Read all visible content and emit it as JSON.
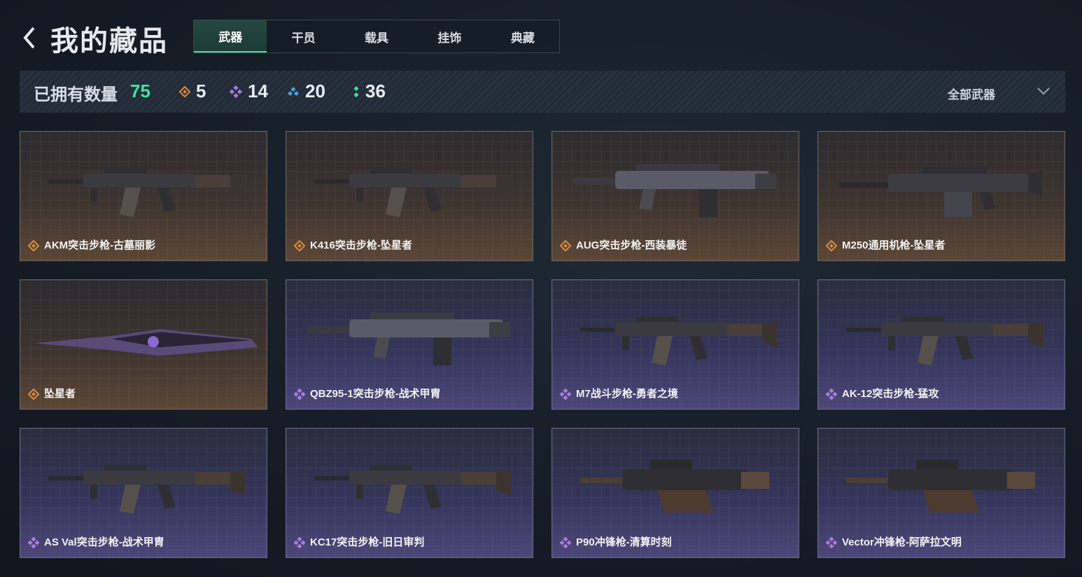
{
  "header": {
    "title": "我的藏品",
    "tabs": [
      {
        "label": "武器",
        "active": true
      },
      {
        "label": "干员",
        "active": false
      },
      {
        "label": "载具",
        "active": false
      },
      {
        "label": "挂饰",
        "active": false
      },
      {
        "label": "典藏",
        "active": false
      }
    ]
  },
  "stats": {
    "owned_label": "已拥有数量",
    "owned_value": "75",
    "rarity_counts": [
      {
        "icon": "orange-diamond-icon",
        "color": "#e08a3c",
        "value": "5"
      },
      {
        "icon": "purple-diamond-icon",
        "color": "#a77be0",
        "value": "14"
      },
      {
        "icon": "blue-diamond-icon",
        "color": "#4aa0e6",
        "value": "20"
      },
      {
        "icon": "green-dots-icon",
        "color": "#3fe39b",
        "value": "36"
      }
    ],
    "filter_label": "全部武器"
  },
  "items": [
    {
      "name": "AKM突击步枪-古墓丽影",
      "rarity": "orange",
      "shape": "rifle"
    },
    {
      "name": "K416突击步枪-坠星者",
      "rarity": "orange",
      "shape": "rifle"
    },
    {
      "name": "AUG突击步枪-西装暴徒",
      "rarity": "orange",
      "shape": "bullpup"
    },
    {
      "name": "M250通用机枪-坠星者",
      "rarity": "orange",
      "shape": "lmg"
    },
    {
      "name": "坠星者",
      "rarity": "orange",
      "shape": "knife"
    },
    {
      "name": "QBZ95-1突击步枪-战术甲胄",
      "rarity": "purple",
      "shape": "bullpup"
    },
    {
      "name": "M7战斗步枪-勇者之境",
      "rarity": "purple",
      "shape": "rifle"
    },
    {
      "name": "AK-12突击步枪-猛攻",
      "rarity": "purple",
      "shape": "rifle"
    },
    {
      "name": "AS Val突击步枪-战术甲胄",
      "rarity": "purple",
      "shape": "rifle"
    },
    {
      "name": "KC17突击步枪-旧日审判",
      "rarity": "purple",
      "shape": "rifle"
    },
    {
      "name": "P90冲锋枪-清算时刻",
      "rarity": "purple",
      "shape": "smg"
    },
    {
      "name": "Vector冲锋枪-阿萨拉文明",
      "rarity": "purple",
      "shape": "smg"
    }
  ],
  "colors": {
    "accent_green": "#3fe39b",
    "orange_rarity": "#e08a3c",
    "purple_rarity": "#a77be0"
  }
}
